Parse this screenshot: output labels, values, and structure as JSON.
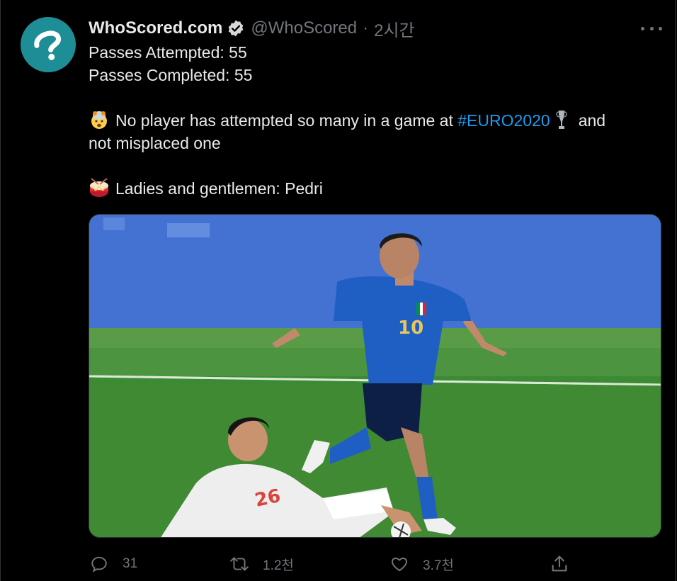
{
  "tweet": {
    "author_name": "WhoScored.com",
    "author_handle": "@WhoScored",
    "separator": "·",
    "timestamp": "2시간",
    "line1": "Passes Attempted: 55",
    "line2": "Passes Completed: 55",
    "line3_pre": "No player has attempted so many in a game at ",
    "hashtag": "#EURO2020",
    "line3_post": "and",
    "line4": "not misplaced one",
    "line5": "Ladies and gentlemen: Pedri",
    "emoji_1": "exploding-head-icon",
    "emoji_2": "drum-icon",
    "trophy_icon": "trophy-icon"
  },
  "media": {
    "player_front_number": "10",
    "player_back_number": "26"
  },
  "actions": {
    "reply_count": "31",
    "retweet_count": "1.2천",
    "like_count": "3.7천",
    "share_icon": "share-icon"
  },
  "colors": {
    "background": "#000000",
    "text": "#e7e9ea",
    "muted": "#71767b",
    "link": "#1d9bf0",
    "avatar": "#1e8e96"
  }
}
